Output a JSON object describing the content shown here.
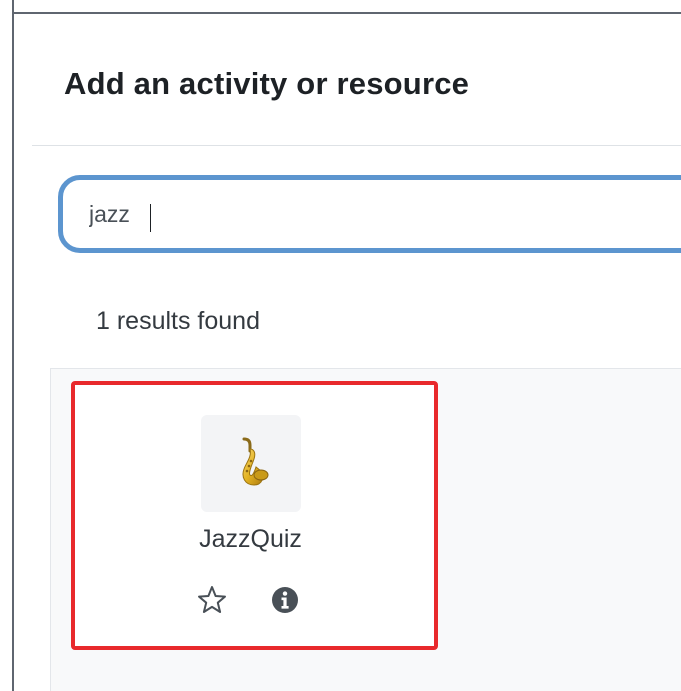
{
  "modal": {
    "title": "Add an activity or resource"
  },
  "search": {
    "value": "jazz",
    "placeholder": ""
  },
  "results": {
    "count_text": "1 results found",
    "items": [
      {
        "name": "JazzQuiz",
        "icon": "saxophone-icon",
        "starred": false
      }
    ]
  },
  "colors": {
    "search_border": "#5c95cf",
    "highlight_border": "#e8292c",
    "title_text": "#1d2125",
    "body_text": "#343a40",
    "results_bg": "#f8f9fa"
  }
}
